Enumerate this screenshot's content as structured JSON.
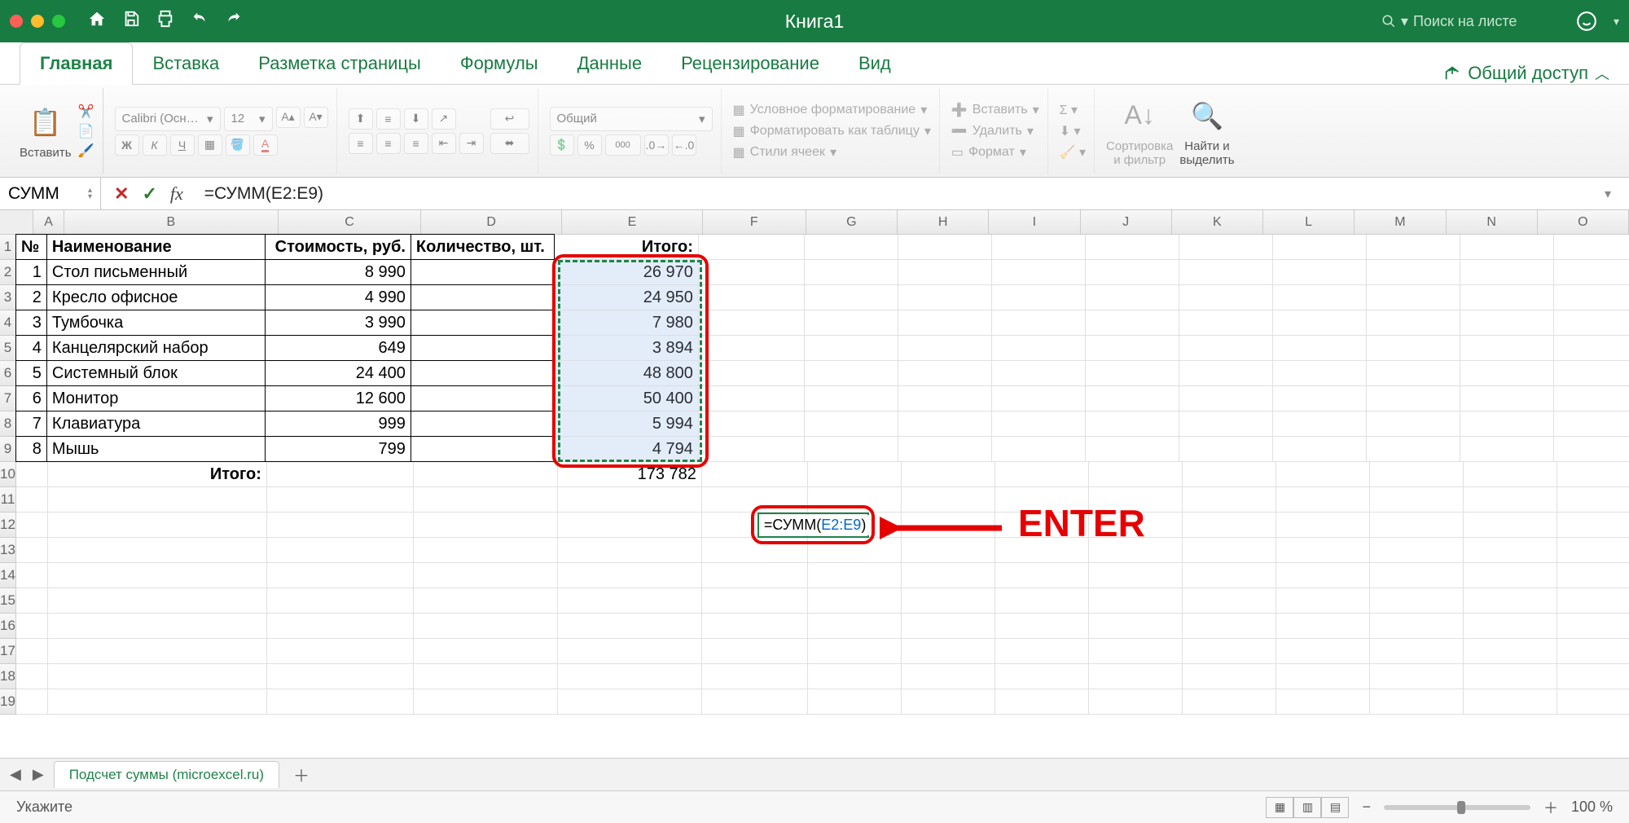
{
  "titlebar": {
    "title": "Книга1",
    "search_placeholder": "Поиск на листе"
  },
  "tabs": {
    "items": [
      "Главная",
      "Вставка",
      "Разметка страницы",
      "Формулы",
      "Данные",
      "Рецензирование",
      "Вид"
    ],
    "share": "Общий доступ"
  },
  "ribbon": {
    "paste": "Вставить",
    "font_name": "Calibri (Осн…",
    "font_size": "12",
    "number_format": "Общий",
    "cond_format": "Условное форматирование",
    "format_table": "Форматировать как таблицу",
    "cell_styles": "Стили ячеек",
    "insert": "Вставить",
    "delete": "Удалить",
    "format": "Формат",
    "sort_filter": "Сортировка\nи фильтр",
    "find_select": "Найти и\nвыделить"
  },
  "formula_bar": {
    "name_box": "СУММ",
    "formula": "=СУММ(E2:E9)"
  },
  "columns": [
    "A",
    "B",
    "C",
    "D",
    "E",
    "F",
    "G",
    "H",
    "I",
    "J",
    "K",
    "L",
    "M",
    "N",
    "O"
  ],
  "headers": {
    "num": "№",
    "name": "Наименование",
    "cost": "Стоимость, руб.",
    "qty": "Количество, шт.",
    "total": "Итого:"
  },
  "rows": [
    {
      "n": "1",
      "name": "Стол письменный",
      "cost": "8 990",
      "total": "26 970"
    },
    {
      "n": "2",
      "name": "Кресло офисное",
      "cost": "4 990",
      "total": "24 950"
    },
    {
      "n": "3",
      "name": "Тумбочка",
      "cost": "3 990",
      "total": "7 980"
    },
    {
      "n": "4",
      "name": "Канцелярский набор",
      "cost": "649",
      "total": "3 894"
    },
    {
      "n": "5",
      "name": "Системный блок",
      "cost": "24 400",
      "total": "48 800"
    },
    {
      "n": "6",
      "name": "Монитор",
      "cost": "12 600",
      "total": "50 400"
    },
    {
      "n": "7",
      "name": "Клавиатура",
      "cost": "999",
      "total": "5 994"
    },
    {
      "n": "8",
      "name": "Мышь",
      "cost": "799",
      "total": "4 794"
    }
  ],
  "footer_row": {
    "label": "Итого:",
    "sum": "173 782"
  },
  "editing_cell": {
    "prefix": "=СУММ(",
    "ref": "E2:E9",
    "suffix": ")"
  },
  "annotation": "ENTER",
  "sheet_tab": "Подсчет суммы (microexcel.ru)",
  "status": {
    "mode": "Укажите",
    "zoom": "100 %"
  }
}
